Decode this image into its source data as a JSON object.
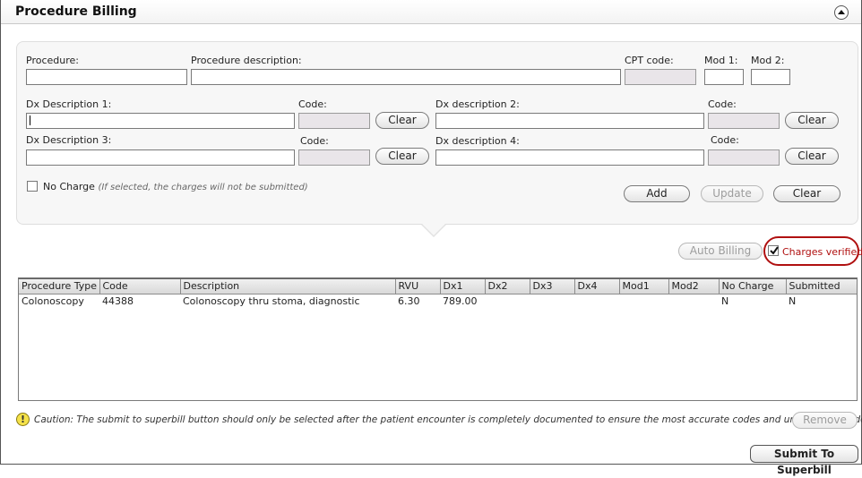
{
  "header": {
    "title": "Procedure Billing"
  },
  "form": {
    "procedure_label": "Procedure:",
    "procedure_value": "",
    "procedure_desc_label": "Procedure description:",
    "procedure_desc_value": "",
    "cpt_label": "CPT code:",
    "cpt_value": "",
    "mod1_label": "Mod 1:",
    "mod1_value": "",
    "mod2_label": "Mod 2:",
    "mod2_value": "",
    "dx1_label": "Dx Description 1:",
    "dx1_value": "",
    "dx1_code_label": "Code:",
    "dx1_code_value": "",
    "dx2_label": "Dx description 2:",
    "dx2_value": "",
    "dx2_code_label": "Code:",
    "dx2_code_value": "",
    "dx3_label": "Dx Description 3:",
    "dx3_value": "",
    "dx3_code_label": "Code:",
    "dx3_code_value": "",
    "dx4_label": "Dx description 4:",
    "dx4_value": "",
    "dx4_code_label": "Code:",
    "dx4_code_value": "",
    "clear_label": "Clear",
    "no_charge_label": "No Charge",
    "no_charge_note": "(If selected, the charges will not be submitted)",
    "no_charge_checked": false,
    "add_label": "Add",
    "update_label": "Update"
  },
  "actions": {
    "auto_billing_label": "Auto Billing",
    "charges_verified_label": "Charges verified",
    "charges_verified_checked": true
  },
  "table": {
    "columns": [
      "Procedure Type",
      "Code",
      "Description",
      "RVU",
      "Dx1",
      "Dx2",
      "Dx3",
      "Dx4",
      "Mod1",
      "Mod2",
      "No Charge",
      "Submitted"
    ],
    "rows": [
      [
        "Colonoscopy",
        "44388",
        "Colonoscopy thru stoma, diagnostic",
        "6.30",
        "789.00",
        "",
        "",
        "",
        "",
        "",
        "N",
        "N"
      ]
    ]
  },
  "footer": {
    "caution_text": "Caution: The submit to superbill button should only be selected after the patient encounter is completely documented to ensure the most accurate codes and units are uploaded.",
    "remove_label": "Remove",
    "submit_label": "Submit To Superbill"
  },
  "colors": {
    "verify_ring": "#b01010",
    "verify_text": "#b01010",
    "caution_icon": "#f5e24a"
  },
  "icons": {
    "collapse": "chevron-up-icon",
    "caution": "warning-icon",
    "checkmark": "checkmark-icon"
  }
}
